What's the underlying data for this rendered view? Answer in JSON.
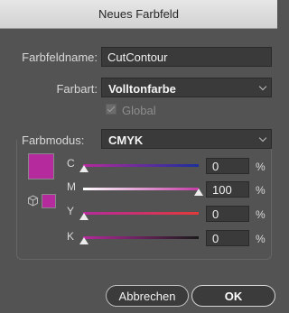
{
  "window": {
    "title": "Neues Farbfeld"
  },
  "form": {
    "name_label": "Farbfeldname:",
    "name_value": "CutContour",
    "type_label": "Farbart:",
    "type_value": "Volltonfarbe",
    "global_label": "Global",
    "global_checked": true,
    "global_enabled": false,
    "mode_label": "Farbmodus:",
    "mode_value": "CMYK"
  },
  "swatch_color": "#b52a9c",
  "sliders": [
    {
      "channel": "C",
      "value": "0",
      "unit": "%"
    },
    {
      "channel": "M",
      "value": "100",
      "unit": "%"
    },
    {
      "channel": "Y",
      "value": "0",
      "unit": "%"
    },
    {
      "channel": "K",
      "value": "0",
      "unit": "%"
    }
  ],
  "icons": {
    "chevron": "chevron-down-icon",
    "checkbox": "checkmark-icon",
    "gamut": "cube-icon"
  },
  "buttons": {
    "cancel": "Abbrechen",
    "ok": "OK"
  }
}
